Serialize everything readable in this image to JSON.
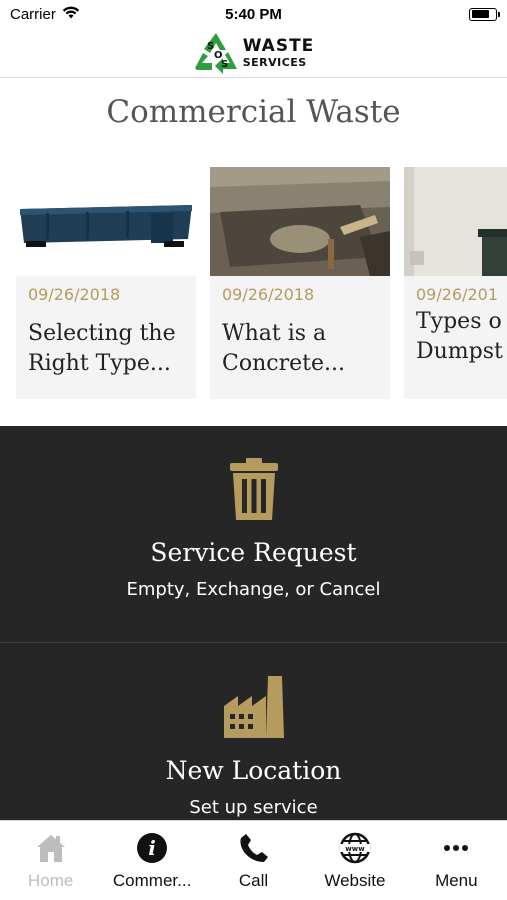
{
  "status_bar": {
    "carrier": "Carrier",
    "time": "5:40 PM",
    "battery_level": 0.75
  },
  "logo": {
    "badge_text": "SOS",
    "line1": "WASTE",
    "line2": "SERVICES",
    "brand_green": "#2f9e3f"
  },
  "page": {
    "title": "Commercial Waste"
  },
  "articles": [
    {
      "date": "09/26/2018",
      "title": "Selecting the\nRight Type..."
    },
    {
      "date": "09/26/2018",
      "title": "What is a\nConcrete..."
    },
    {
      "date": "09/26/201",
      "title": "Types o\nDumpst"
    }
  ],
  "actions": {
    "service_request": {
      "icon": "trash-can-icon",
      "title": "Service Request",
      "subtitle": "Empty, Exchange, or Cancel"
    },
    "new_location": {
      "icon": "factory-icon",
      "title": "New Location",
      "subtitle": "Set up service"
    }
  },
  "tabs": [
    {
      "label": "Home",
      "icon": "home-icon",
      "active": false
    },
    {
      "label": "Commer...",
      "icon": "info-icon",
      "active": true
    },
    {
      "label": "Call",
      "icon": "phone-icon",
      "active": true
    },
    {
      "label": "Website",
      "icon": "globe-icon",
      "active": true
    },
    {
      "label": "Menu",
      "icon": "more-icon",
      "active": true
    }
  ],
  "colors": {
    "accent_gold": "#b59b5e",
    "dark_panel": "#262626"
  }
}
